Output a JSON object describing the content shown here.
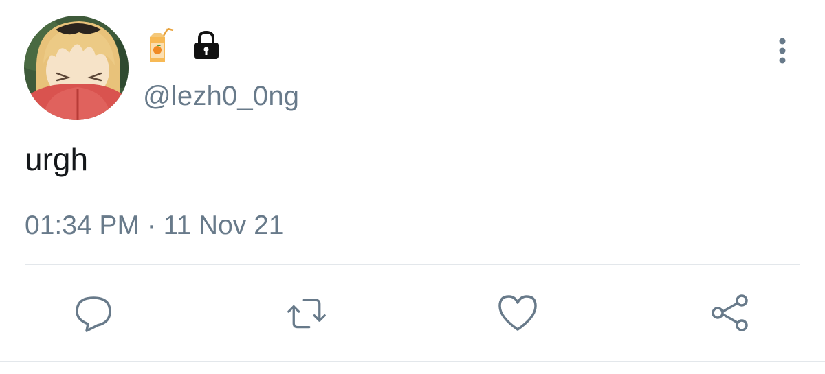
{
  "tweet": {
    "name_emoji": "juice-box-emoji",
    "lock_icon": "lock-icon",
    "handle": "@lezh0_0ng",
    "text": "urgh",
    "timestamp": "01:34 PM · 11 Nov 21"
  },
  "actions": {
    "reply": "reply-icon",
    "retweet": "retweet-icon",
    "like": "heart-icon",
    "share": "share-icon"
  },
  "colors": {
    "secondary_text": "#687a8a",
    "primary_text": "#14171a",
    "divider": "#e3e7eb",
    "icon": "#687a8a"
  }
}
